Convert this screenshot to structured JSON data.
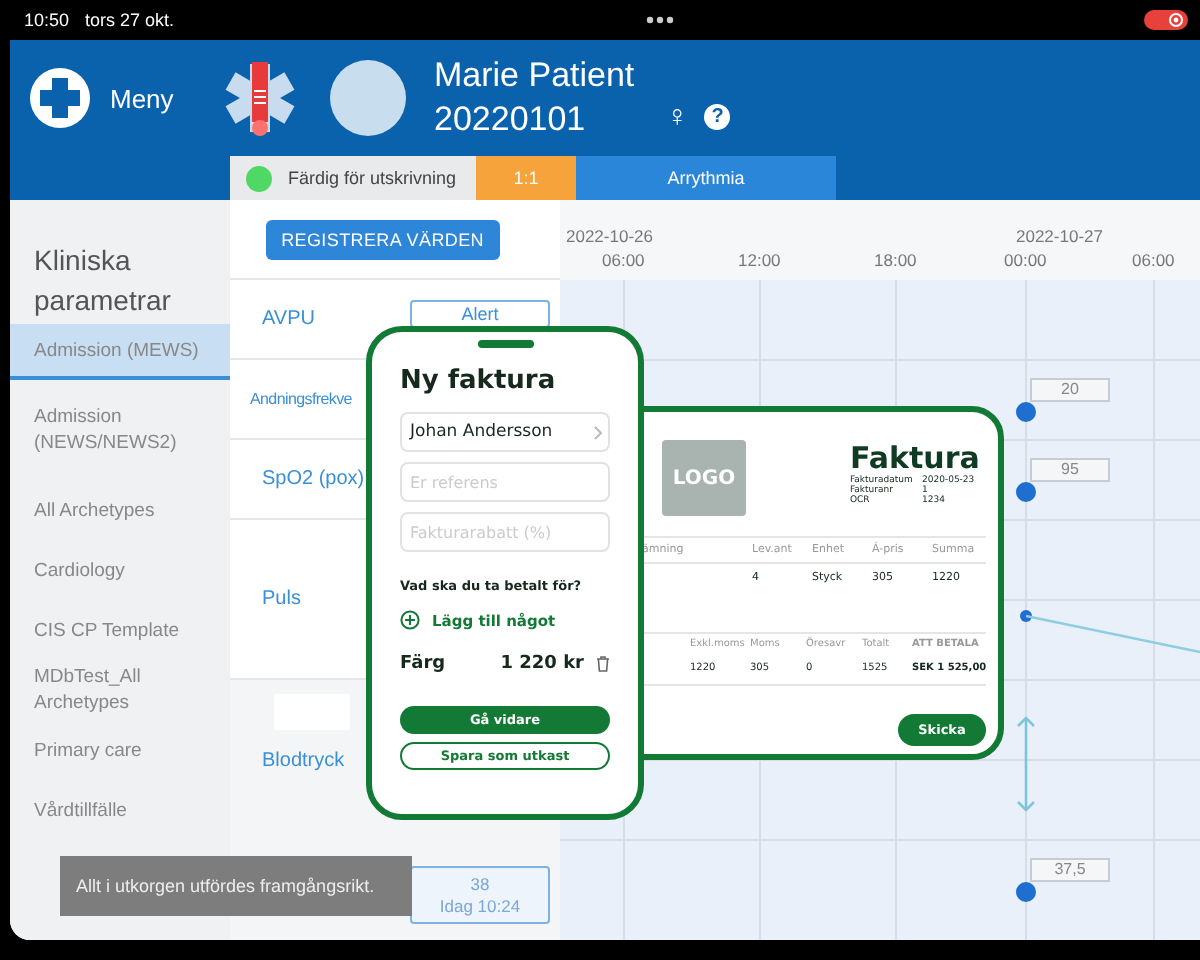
{
  "status_bar": {
    "time": "10:50",
    "date": "tors 27 okt."
  },
  "header": {
    "menu_label": "Meny",
    "patient_name": "Marie Patient",
    "patient_id": "20220101",
    "gender_symbol": "♀",
    "help_symbol": "?"
  },
  "flags": [
    {
      "kind": "status",
      "label": "Färdig för utskrivning"
    },
    {
      "kind": "ratio",
      "label": "1:1"
    },
    {
      "kind": "alert",
      "label": "Arrythmia"
    }
  ],
  "sidebar": {
    "title": "Kliniska parametrar",
    "items": [
      {
        "label": "Admission (MEWS)",
        "selected": true
      },
      {
        "label": "Admission (NEWS/NEWS2)",
        "selected": false
      },
      {
        "label": "All Archetypes",
        "selected": false
      },
      {
        "label": "Cardiology",
        "selected": false
      },
      {
        "label": "CIS CP Template",
        "selected": false
      },
      {
        "label": "MDbTest_All Archetypes",
        "selected": false
      },
      {
        "label": "Primary care",
        "selected": false
      },
      {
        "label": "Vårdtillfälle",
        "selected": false
      }
    ]
  },
  "parameters": {
    "register_button": "REGISTRERA VÄRDEN",
    "rows": [
      {
        "label": "AVPU",
        "value": "Alert"
      },
      {
        "label": "Andningsfrekve"
      },
      {
        "label": "SpO2 (pox)"
      },
      {
        "label": "Puls"
      },
      {
        "label": "Blodtryck"
      }
    ],
    "latest": {
      "value": "38",
      "time": "Idag 10:24"
    }
  },
  "chart": {
    "date_labels": [
      "2022-10-26",
      "2022-10-27"
    ],
    "time_labels": [
      "06:00",
      "12:00",
      "18:00",
      "00:00",
      "06:00"
    ],
    "readings": [
      {
        "value": "20"
      },
      {
        "value": "95"
      },
      {
        "value": "37,5"
      }
    ]
  },
  "phone": {
    "title": "Ny faktura",
    "customer": "Johan Andersson",
    "fields": [
      {
        "placeholder": "Er referens"
      },
      {
        "placeholder": "Fakturarabatt (%)"
      }
    ],
    "question": "Vad ska du ta betalt för?",
    "add_label": "Lägg till något",
    "item_name": "Färg",
    "item_price": "1 220 kr",
    "primary_button": "Gå vidare",
    "secondary_button": "Spara som utkast"
  },
  "invoice": {
    "logo": "LOGO",
    "title": "Faktura",
    "meta": [
      {
        "label": "Fakturadatum",
        "value": "2020-05-23"
      },
      {
        "label": "Fakturanr",
        "value": "1"
      },
      {
        "label": "OCR",
        "value": "1234"
      }
    ],
    "columns": [
      "ämning",
      "Lev.ant",
      "Enhet",
      "Á-pris",
      "Summa"
    ],
    "line_items": [
      {
        "quantity": "4",
        "unit": "Styck",
        "price": "305",
        "sum": "1220"
      }
    ],
    "totals": {
      "columns": [
        "Exkl.moms",
        "Moms",
        "Öresavr",
        "Totalt"
      ],
      "values": [
        "1220",
        "305",
        "0",
        "1525"
      ],
      "due_label": "ATT BETALA",
      "due_value": "SEK 1 525,00"
    },
    "send_button": "Skicka"
  },
  "toast": {
    "message": "Allt i utkorgen utfördes framgångsrikt."
  }
}
